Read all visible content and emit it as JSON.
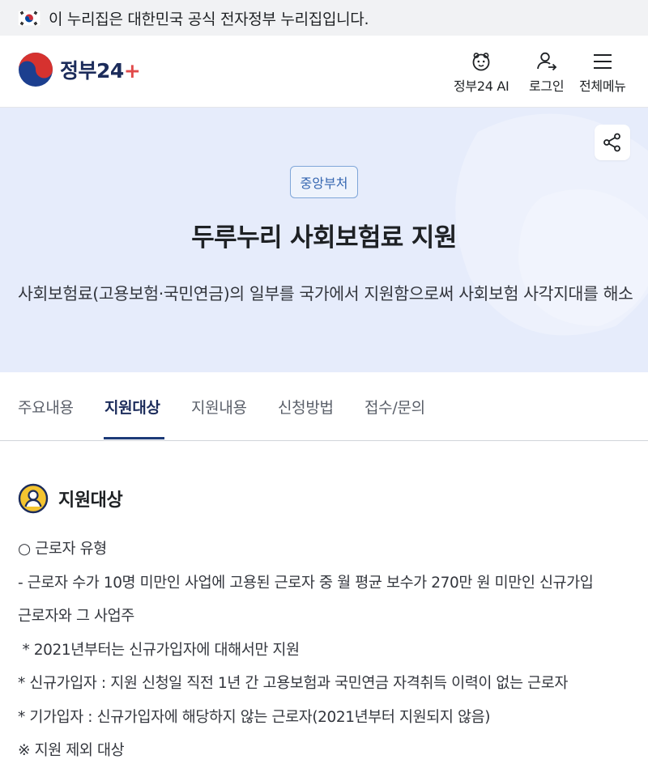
{
  "gov_banner": {
    "flag_icon": "korea-flag-icon",
    "text": "이 누리집은 대한민국 공식 전자정부 누리집입니다."
  },
  "header": {
    "logo_text": "정부",
    "logo_num": "24",
    "ai_label": "정부24 AI",
    "login_label": "로그인",
    "menu_label": "전체메뉴"
  },
  "hero": {
    "badge": "중앙부처",
    "title": "두루누리 사회보험료 지원",
    "description": "사회보험료(고용보험·국민연금)의 일부를 국가에서 지원함으로써 사회보험 사각지대를 해소"
  },
  "tabs": [
    {
      "label": "주요내용",
      "active": false
    },
    {
      "label": "지원대상",
      "active": true
    },
    {
      "label": "지원내용",
      "active": false
    },
    {
      "label": "신청방법",
      "active": false
    },
    {
      "label": "접수/문의",
      "active": false
    }
  ],
  "section": {
    "icon": "user-circle-icon",
    "title": "지원대상",
    "lines": [
      "○ 근로자 유형",
      "- 근로자 수가 10명 미만인 사업에 고용된 근로자 중 월 평균 보수가 270만 원 미만인 신규가입",
      "근로자와 그 사업주",
      " * 2021년부터는 신규가입자에 대해서만 지원",
      "* 신규가입자 : 지원 신청일 직전 1년 간 고용보험과 국민연금 자격취득 이력이 없는 근로자",
      "* 기가입자 : 신규가입자에 해당하지 않는 근로자(2021년부터 지원되지 않음)",
      "※ 지원 제외 대상"
    ]
  },
  "colors": {
    "hero_bg": "#e6ecfb",
    "brand_navy": "#1c2c5b",
    "badge_blue": "#3566b0"
  }
}
